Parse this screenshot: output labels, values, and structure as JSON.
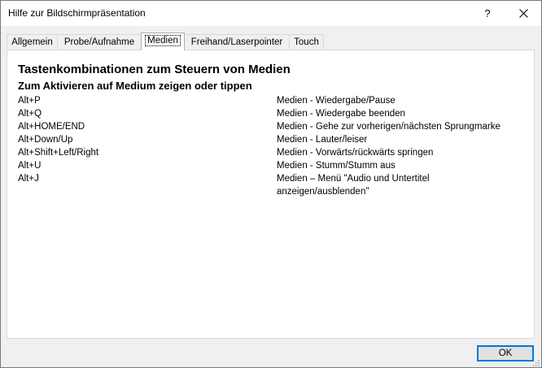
{
  "window": {
    "title": "Hilfe zur Bildschirmpräsentation",
    "help_label": "?",
    "close_icon": "close-icon"
  },
  "tabs": [
    {
      "label": "Allgemein",
      "active": false
    },
    {
      "label": "Probe/Aufnahme",
      "active": false
    },
    {
      "label": "Medien",
      "active": true
    },
    {
      "label": "Freihand/Laserpointer",
      "active": false
    },
    {
      "label": "Touch",
      "active": false
    }
  ],
  "content": {
    "heading": "Tastenkombinationen zum Steuern von Medien",
    "subheading": "Zum Aktivieren auf Medium zeigen oder tippen",
    "shortcuts": [
      {
        "key": "Alt+P",
        "desc": "Medien - Wiedergabe/Pause"
      },
      {
        "key": "Alt+Q",
        "desc": "Medien - Wiedergabe beenden"
      },
      {
        "key": "Alt+HOME/END",
        "desc": "Medien - Gehe zur vorherigen/nächsten Sprungmarke"
      },
      {
        "key": "Alt+Down/Up",
        "desc": "Medien - Lauter/leiser"
      },
      {
        "key": "Alt+Shift+Left/Right",
        "desc": "Medien - Vorwärts/rückwärts springen"
      },
      {
        "key": "Alt+U",
        "desc": "Medien - Stumm/Stumm aus"
      },
      {
        "key": "Alt+J",
        "desc": "Medien – Menü \"Audio und Untertitel anzeigen/ausblenden\""
      }
    ]
  },
  "footer": {
    "ok_label": "OK"
  },
  "colors": {
    "accent": "#0078d7",
    "dialog_bg": "#f0f0f0",
    "panel_bg": "#ffffff"
  }
}
